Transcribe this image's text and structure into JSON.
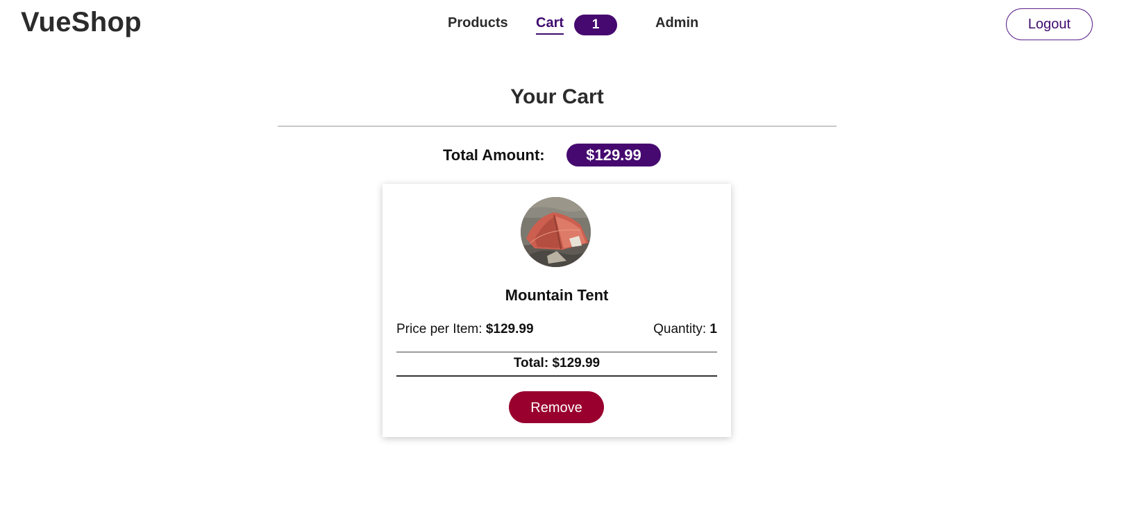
{
  "header": {
    "brand": "VueShop",
    "nav": {
      "products_label": "Products",
      "cart_label": "Cart",
      "cart_count": "1",
      "admin_label": "Admin"
    },
    "logout_label": "Logout"
  },
  "cart": {
    "title": "Your Cart",
    "total_label": "Total Amount:",
    "total_value": "$129.99",
    "items": [
      {
        "name": "Mountain Tent",
        "image_icon": "tent-photo",
        "price_label": "Price per Item:",
        "price_value": "$129.99",
        "quantity_label": "Quantity:",
        "quantity_value": "1",
        "item_total": "Total: $129.99",
        "remove_label": "Remove"
      }
    ]
  },
  "colors": {
    "accent_purple": "#45096f",
    "remove_red": "#99002e"
  }
}
